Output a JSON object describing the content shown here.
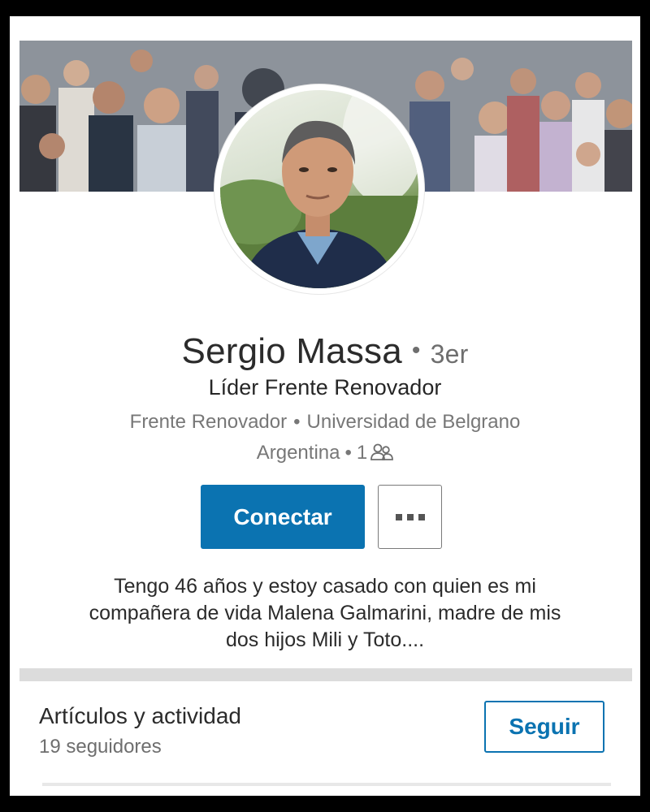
{
  "profile": {
    "name": "Sergio Massa",
    "connection_degree": "3er",
    "headline": "Líder Frente Renovador",
    "company": "Frente Renovador",
    "school": "Universidad de Belgrano",
    "location": "Argentina",
    "connections_count": "1",
    "connections_icon": "people-icon"
  },
  "actions": {
    "connect_label": "Conectar",
    "more_icon": "more-options-icon"
  },
  "summary": {
    "lines": [
      "Tengo 46 años y estoy casado con quien es mi",
      "compañera de vida Malena Galmarini, madre de mis",
      "dos hijos Mili y Toto...."
    ]
  },
  "activity": {
    "title": "Artículos y actividad",
    "followers": "19 seguidores",
    "follow_label": "Seguir"
  },
  "colors": {
    "primary_blue": "#0b73b1",
    "text_dark": "#2b2b2b",
    "text_muted": "#777777",
    "divider": "#dcdcdc"
  }
}
